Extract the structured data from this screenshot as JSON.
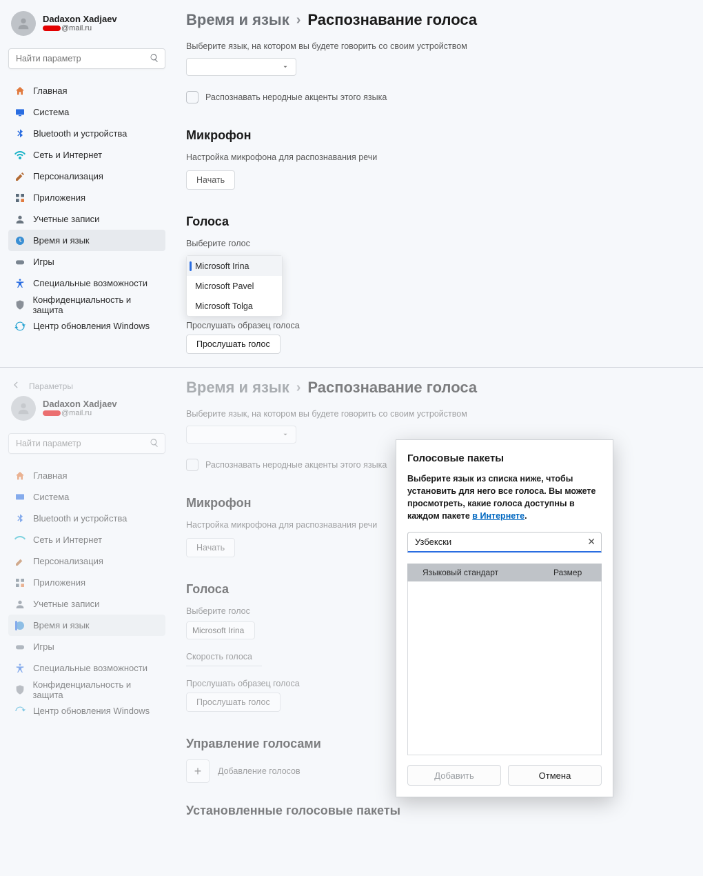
{
  "user": {
    "name": "Dadaxon Xadjaev",
    "mail_suffix": "@mail.ru"
  },
  "search": {
    "placeholder": "Найти параметр"
  },
  "nav": {
    "home": "Главная",
    "system": "Система",
    "bluetooth": "Bluetooth и устройства",
    "network": "Сеть и Интернет",
    "personalize": "Персонализация",
    "apps": "Приложения",
    "accounts": "Учетные записи",
    "time": "Время и язык",
    "games": "Игры",
    "accessibility": "Специальные возможности",
    "privacy": "Конфиденциальность и защита",
    "update": "Центр обновления Windows"
  },
  "breadcrumb": {
    "p1": "Время и язык",
    "p2": "Распознавание голоса"
  },
  "lang_section": {
    "desc": "Выберите язык, на котором вы будете говорить со своим устройством",
    "checkbox": "Распознавать неродные акценты этого языка"
  },
  "mic": {
    "title": "Микрофон",
    "desc": "Настройка микрофона для распознавания речи",
    "btn": "Начать"
  },
  "voices_top": {
    "title": "Голоса",
    "choose": "Выберите голос",
    "options": [
      "Microsoft Irina",
      "Microsoft Pavel",
      "Microsoft Tolga"
    ],
    "preview_lbl": "Прослушать образец голоса",
    "preview_btn": "Прослушать голос"
  },
  "back_label": "Параметры",
  "voices_bot": {
    "title": "Голоса",
    "choose": "Выберите голос",
    "selected": "Microsoft Irina",
    "speed": "Скорость голоса",
    "preview_lbl": "Прослушать образец голоса",
    "preview_btn": "Прослушать голос"
  },
  "manage": {
    "title": "Управление голосами",
    "add": "Добавление голосов"
  },
  "installed": {
    "title": "Установленные голосовые пакеты"
  },
  "dialog": {
    "title": "Голосовые пакеты",
    "desc1": "Выберите язык из списка ниже, чтобы установить для него все голоса. Вы можете просмотреть, какие голоса доступны в каждом пакете ",
    "link": "в Интернете",
    "desc2": ".",
    "input_value": "Узбекски",
    "col1": "Языковый стандарт",
    "col2": "Размер",
    "add": "Добавить",
    "cancel": "Отмена"
  }
}
